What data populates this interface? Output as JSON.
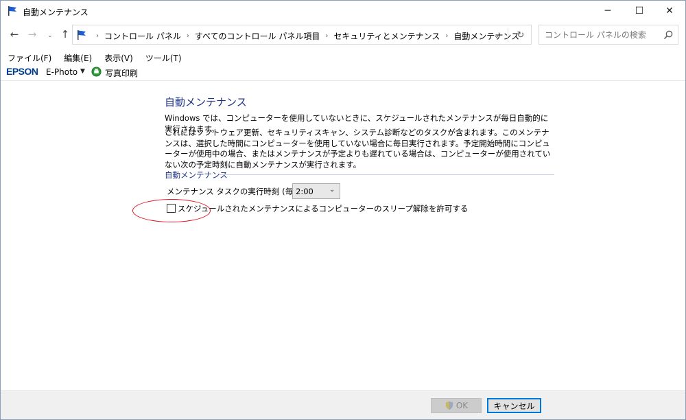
{
  "window": {
    "title": "自動メンテナンス",
    "icon": "flag-icon",
    "controls": {
      "minimize": "─",
      "maximize": "☐",
      "close": "✕"
    }
  },
  "nav": {
    "back": "←",
    "forward": "→",
    "recent": "⌄",
    "up": "↑",
    "breadcrumbs": [
      "コントロール パネル",
      "すべてのコントロール パネル項目",
      "セキュリティとメンテナンス",
      "自動メンテナンス"
    ],
    "separator": "›",
    "dropdown": "⌄",
    "refresh": "↻"
  },
  "search": {
    "placeholder": "コントロール パネルの検索",
    "value": ""
  },
  "menu": {
    "items": [
      {
        "label": "ファイル(F)"
      },
      {
        "label": "編集(E)"
      },
      {
        "label": "表示(V)"
      },
      {
        "label": "ツール(T)"
      }
    ]
  },
  "epson_toolbar": {
    "logo": "EPSON",
    "app": "E-Photo",
    "caret": "▼",
    "print_label": "写真印刷"
  },
  "content": {
    "title": "自動メンテナンス",
    "para1": "Windows では、コンピューターを使用していないときに、スケジュールされたメンテナンスが毎日自動的に実行されます。",
    "para2": "これにはソフトウェア更新、セキュリティスキャン、システム診断などのタスクが含まれます。このメンテナンスは、選択した時間にコンピューターを使用していない場合に毎日実行されます。予定開始時間にコンピューターが使用中の場合、またはメンテナンスが予定よりも遅れている場合は、コンピューターが使用されていない次の予定時刻に自動メンテナンスが実行されます。",
    "group_label": "自動メンテナンス",
    "time_label": "メンテナンス タスクの実行時刻 (毎日):",
    "time_value": "2:00",
    "time_caret": "⌄",
    "wake_checkbox_label": "スケジュールされたメンテナンスによるコンピューターのスリープ解除を許可する",
    "wake_checkbox_checked": false
  },
  "footer": {
    "ok_label": "OK",
    "cancel_label": "キャンセル"
  },
  "colors": {
    "heading": "#1e3287",
    "annotation": "#e0141e",
    "focus": "#0078d7"
  }
}
